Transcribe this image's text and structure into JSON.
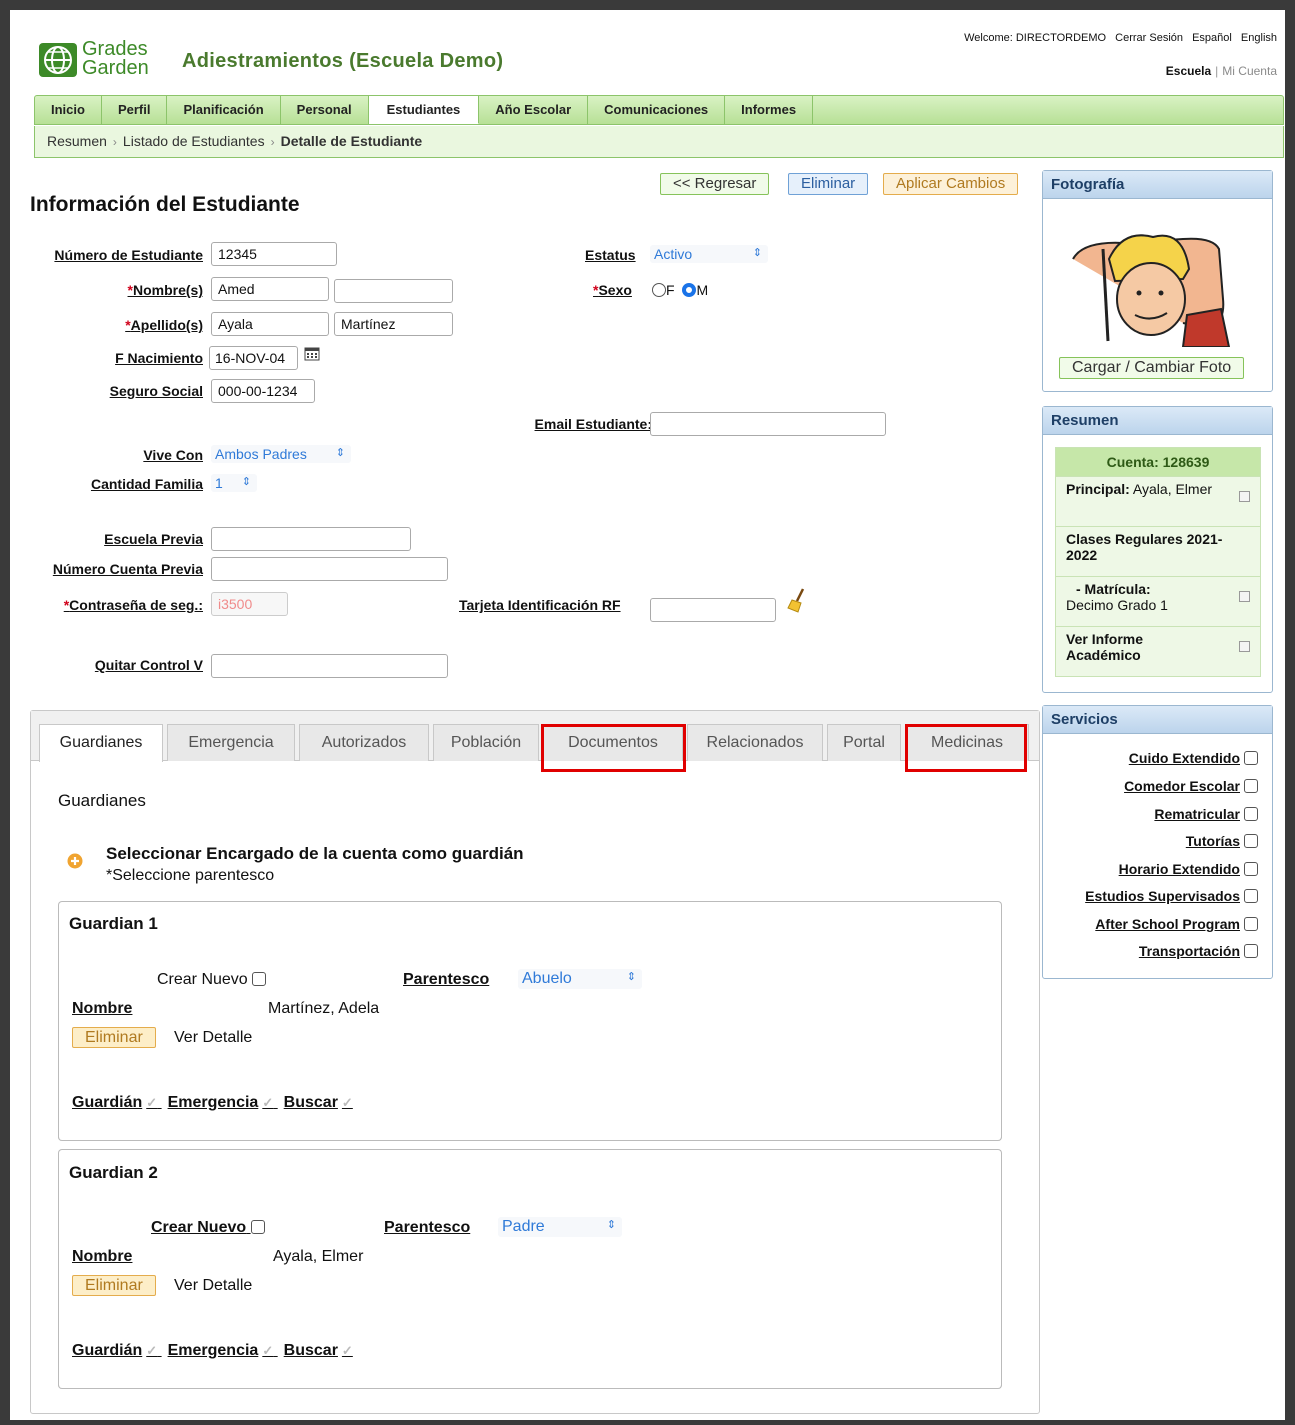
{
  "header": {
    "app_title": "Adiestramientos (Escuela Demo)",
    "logo_top": "Grades",
    "logo_bottom": "Garden",
    "welcome": "Welcome: DIRECTORDEMO",
    "logout": "Cerrar Sesión",
    "lang_es": "Español",
    "lang_en": "English",
    "escuela": "Escuela",
    "mi_cuenta": "Mi Cuenta"
  },
  "nav": [
    "Inicio",
    "Perfil",
    "Planificación",
    "Personal",
    "Estudiantes",
    "Año Escolar",
    "Comunicaciones",
    "Informes"
  ],
  "breadcrumb": [
    "Resumen",
    "Listado de Estudiantes",
    "Detalle de Estudiante"
  ],
  "actions": {
    "back": "<< Regresar",
    "delete": "Eliminar",
    "apply": "Aplicar Cambios"
  },
  "page_title": "Información del Estudiante",
  "form": {
    "student_number_label": "Número de Estudiante",
    "student_number": "12345",
    "names_label": "Nombre(s)",
    "first_name": "Amed",
    "middle_name": "",
    "lastnames_label": "Apellido(s)",
    "last_name1": "Ayala",
    "last_name2": "Martínez",
    "birth_label": "F Nacimiento",
    "birth": "16-NOV-04",
    "ssn_label": "Seguro Social",
    "ssn": "000-00-1234",
    "status_label": "Estatus",
    "status": "Activo",
    "sex_label": "Sexo",
    "sex_f": "F",
    "sex_m": "M",
    "email_label": "Email Estudiante:",
    "email": "",
    "lives_with_label": "Vive Con",
    "lives_with": "Ambos Padres",
    "family_count_label": "Cantidad Familia",
    "family_count": "1",
    "prev_school_label": "Escuela Previa",
    "prev_account_label": "Número Cuenta Previa",
    "security_label": "Contraseña de seg.:",
    "security": "i3500",
    "rfid_label": "Tarjeta Identificación RF",
    "remove_v_label": "Quitar Control V"
  },
  "photo": {
    "title": "Fotografía",
    "upload": "Cargar / Cambiar Foto"
  },
  "summary": {
    "title": "Resumen",
    "account": "Cuenta: 128639",
    "principal_label": "Principal:",
    "principal_value": "Ayala, Elmer",
    "classes": "Clases Regulares 2021-2022",
    "enrollment_label": "- Matrícula:",
    "enrollment_value": "Decimo Grado 1",
    "report": "Ver Informe Académico"
  },
  "services": {
    "title": "Servicios",
    "items": [
      "Cuido Extendido",
      "Comedor Escolar",
      "Rematricular",
      "Tutorías",
      "Horario Extendido",
      "Estudios Supervisados",
      "After School Program",
      "Transportación"
    ]
  },
  "tabs": [
    "Guardianes",
    "Emergencia",
    "Autorizados",
    "Población",
    "Documentos",
    "Relacionados",
    "Portal",
    "Medicinas"
  ],
  "guardians": {
    "section_title": "Guardianes",
    "select_title": "Seleccionar Encargado de la cuenta como guardián",
    "select_hint": "*Seleccione parentesco",
    "list": [
      {
        "title": "Guardian 1",
        "create_new": "Crear Nuevo",
        "relation_label": "Parentesco",
        "relation": "Abuelo",
        "name_label": "Nombre",
        "name": "Martínez, Adela",
        "delete": "Eliminar",
        "detail": "Ver Detalle",
        "guardian": "Guardián",
        "emergency": "Emergencia",
        "search": "Buscar"
      },
      {
        "title": "Guardian 2",
        "create_new": "Crear Nuevo",
        "relation_label": "Parentesco",
        "relation": "Padre",
        "name_label": "Nombre",
        "name": "Ayala, Elmer",
        "delete": "Eliminar",
        "detail": "Ver Detalle",
        "guardian": "Guardián",
        "emergency": "Emergencia",
        "search": "Buscar"
      }
    ]
  },
  "colors": {
    "nav_green": "#b7e096",
    "panel_blue": "#bcd4ec",
    "highlight": "#e00000",
    "select_blue": "#2f7ad8"
  }
}
